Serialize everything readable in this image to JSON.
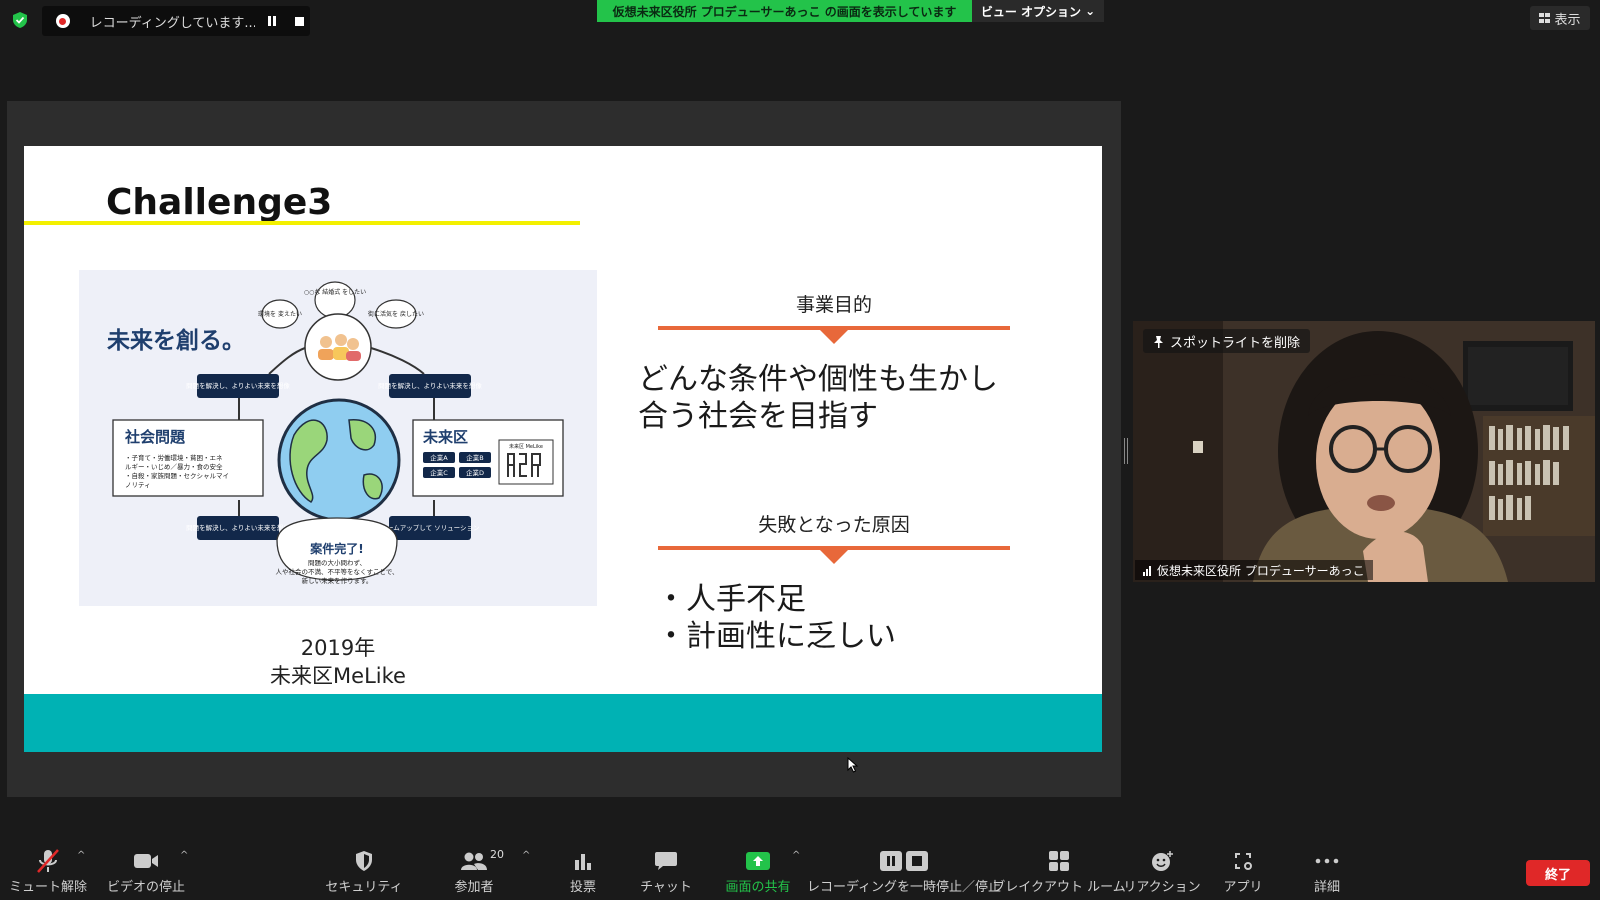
{
  "top": {
    "recording_status": "レコーディングしています...",
    "share_banner": "仮想未来区役所 プロデューサーあっこ の画面を表示しています",
    "view_options": "ビュー オプション",
    "view_options_caret": "⌄",
    "display_button": "表示"
  },
  "slide": {
    "title": "Challenge3",
    "caption_line1": "2019年",
    "caption_line2": "未来区MeLike",
    "section1_heading": "事業目的",
    "section1_line1": "どんな条件や個性も生かし",
    "section1_line2": "合う社会を目指す",
    "section2_heading": "失敗となった原因",
    "bullet1": "・人手不足",
    "bullet2": "・計画性に乏しい",
    "illustration": {
      "headline": "未来を創る。",
      "bubble_top": "○○な 結婚式 をしたい",
      "bubble_left": "環境を 変えたい",
      "bubble_right": "街に活気を 戻したい",
      "arrow_label_tl": "問題を解決し、よりよい未来を想像",
      "arrow_label_tr": "問題を解決し、よりよい未来を想像",
      "arrow_label_bl": "問題を解決し、よりよい未来を想像",
      "arrow_label_br": "チームアップして ソリューション",
      "box_left_title": "社会問題",
      "box_left_text1": "・子育て・労働環境・貧困・エネ",
      "box_left_text2": "ルギー・いじめ／暴力・食の安全",
      "box_left_text3": "・自殺・家族問題・セクシャルマイ",
      "box_left_text4": "ノリティ",
      "box_right_title": "未来区",
      "box_right_badge": "未来区 MeLike",
      "company_a": "企業A",
      "company_b": "企業B",
      "company_c": "企業C",
      "company_d": "企業D",
      "done_title": "案件完了!",
      "done_text1": "問題の大小問わず、",
      "done_text2": "人や社会の不満、不平等をなくすことで、",
      "done_text3": "新しい未来を作ります。"
    }
  },
  "video": {
    "spotlight_button": "スポットライトを削除",
    "participant_name": "仮想未来区役所 プロデューサーあっこ"
  },
  "toolbar": {
    "mute": "ミュート解除",
    "video": "ビデオの停止",
    "security": "セキュリティ",
    "participants": "参加者",
    "participants_count": "20",
    "caret": "^",
    "poll": "投票",
    "chat": "チャット",
    "share": "画面の共有",
    "recording": "レコーディングを一時停止／停止",
    "breakout": "ブレイクアウト ルーム",
    "reactions": "リアクション",
    "apps": "アプリ",
    "more": "詳細",
    "end": "終了"
  }
}
